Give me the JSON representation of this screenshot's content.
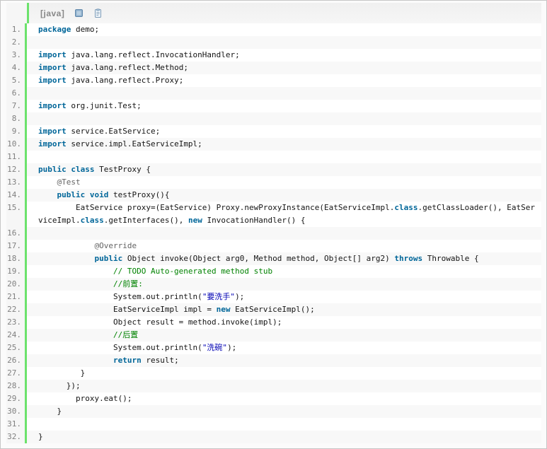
{
  "header": {
    "language_label": "[java]",
    "icons": [
      {
        "name": "view-source-icon"
      },
      {
        "name": "copy-icon"
      }
    ]
  },
  "colors": {
    "keyword": "#006699",
    "plain": "#141414",
    "comment": "#008200",
    "string": "#0000B3",
    "annotation": "#646464",
    "line_number": "#808080",
    "gutter_bg": "#f6f6f6",
    "gutter_border": "#6CE26C",
    "alt_row": "#f8f8f8",
    "header_label": "#888888"
  },
  "code": {
    "language": "java",
    "lines": [
      {
        "number": "1.",
        "segments": [
          {
            "text": "package",
            "type": "keyword"
          },
          {
            "text": " demo;",
            "type": "plain"
          }
        ]
      },
      {
        "number": "2.",
        "segments": []
      },
      {
        "number": "3.",
        "segments": [
          {
            "text": "import",
            "type": "keyword"
          },
          {
            "text": " java.lang.reflect.InvocationHandler;",
            "type": "plain"
          }
        ]
      },
      {
        "number": "4.",
        "segments": [
          {
            "text": "import",
            "type": "keyword"
          },
          {
            "text": " java.lang.reflect.Method;",
            "type": "plain"
          }
        ]
      },
      {
        "number": "5.",
        "segments": [
          {
            "text": "import",
            "type": "keyword"
          },
          {
            "text": " java.lang.reflect.Proxy;",
            "type": "plain"
          }
        ]
      },
      {
        "number": "6.",
        "segments": []
      },
      {
        "number": "7.",
        "segments": [
          {
            "text": "import",
            "type": "keyword"
          },
          {
            "text": " org.junit.Test;",
            "type": "plain"
          }
        ]
      },
      {
        "number": "8.",
        "segments": []
      },
      {
        "number": "9.",
        "segments": [
          {
            "text": "import",
            "type": "keyword"
          },
          {
            "text": " service.EatService;",
            "type": "plain"
          }
        ]
      },
      {
        "number": "10.",
        "segments": [
          {
            "text": "import",
            "type": "keyword"
          },
          {
            "text": " service.impl.EatServiceImpl;",
            "type": "plain"
          }
        ]
      },
      {
        "number": "11.",
        "segments": []
      },
      {
        "number": "12.",
        "segments": [
          {
            "text": "public",
            "type": "keyword"
          },
          {
            "text": " ",
            "type": "plain"
          },
          {
            "text": "class",
            "type": "keyword"
          },
          {
            "text": " TestProxy {",
            "type": "plain"
          }
        ]
      },
      {
        "number": "13.",
        "segments": [
          {
            "text": "    ",
            "type": "plain"
          },
          {
            "text": "@Test",
            "type": "annotation"
          }
        ]
      },
      {
        "number": "14.",
        "segments": [
          {
            "text": "    ",
            "type": "plain"
          },
          {
            "text": "public",
            "type": "keyword"
          },
          {
            "text": " ",
            "type": "plain"
          },
          {
            "text": "void",
            "type": "keyword"
          },
          {
            "text": " testProxy(){",
            "type": "plain"
          }
        ]
      },
      {
        "number": "15.",
        "segments": [
          {
            "text": "        EatService proxy=(EatService) Proxy.newProxyInstance(EatServiceImpl.",
            "type": "plain"
          },
          {
            "text": "class",
            "type": "keyword"
          },
          {
            "text": ".getClassLoader(), EatSer\nviceImpl.",
            "type": "plain"
          },
          {
            "text": "class",
            "type": "keyword"
          },
          {
            "text": ".getInterfaces(), ",
            "type": "plain"
          },
          {
            "text": "new",
            "type": "keyword"
          },
          {
            "text": " InvocationHandler() {",
            "type": "plain"
          }
        ]
      },
      {
        "number": "16.",
        "segments": []
      },
      {
        "number": "17.",
        "segments": [
          {
            "text": "            ",
            "type": "plain"
          },
          {
            "text": "@Override",
            "type": "annotation"
          }
        ]
      },
      {
        "number": "18.",
        "segments": [
          {
            "text": "            ",
            "type": "plain"
          },
          {
            "text": "public",
            "type": "keyword"
          },
          {
            "text": " Object invoke(Object arg0, Method method, Object[] arg2) ",
            "type": "plain"
          },
          {
            "text": "throws",
            "type": "keyword"
          },
          {
            "text": " Throwable {",
            "type": "plain"
          }
        ]
      },
      {
        "number": "19.",
        "segments": [
          {
            "text": "                ",
            "type": "plain"
          },
          {
            "text": "// TODO Auto-generated method stub",
            "type": "comment"
          }
        ]
      },
      {
        "number": "20.",
        "segments": [
          {
            "text": "                ",
            "type": "plain"
          },
          {
            "text": "//前置:",
            "type": "comment"
          }
        ]
      },
      {
        "number": "21.",
        "segments": [
          {
            "text": "                System.out.println(",
            "type": "plain"
          },
          {
            "text": "\"要洗手\"",
            "type": "string"
          },
          {
            "text": ");",
            "type": "plain"
          }
        ]
      },
      {
        "number": "22.",
        "segments": [
          {
            "text": "                EatServiceImpl impl = ",
            "type": "plain"
          },
          {
            "text": "new",
            "type": "keyword"
          },
          {
            "text": " EatServiceImpl();",
            "type": "plain"
          }
        ]
      },
      {
        "number": "23.",
        "segments": [
          {
            "text": "                Object result = method.invoke(impl);",
            "type": "plain"
          }
        ]
      },
      {
        "number": "24.",
        "segments": [
          {
            "text": "                ",
            "type": "plain"
          },
          {
            "text": "//后置",
            "type": "comment"
          }
        ]
      },
      {
        "number": "25.",
        "segments": [
          {
            "text": "                System.out.println(",
            "type": "plain"
          },
          {
            "text": "\"洗碗\"",
            "type": "string"
          },
          {
            "text": ");",
            "type": "plain"
          }
        ]
      },
      {
        "number": "26.",
        "segments": [
          {
            "text": "                ",
            "type": "plain"
          },
          {
            "text": "return",
            "type": "keyword"
          },
          {
            "text": " result;",
            "type": "plain"
          }
        ]
      },
      {
        "number": "27.",
        "segments": [
          {
            "text": "         }",
            "type": "plain"
          }
        ]
      },
      {
        "number": "28.",
        "segments": [
          {
            "text": "      });",
            "type": "plain"
          }
        ]
      },
      {
        "number": "29.",
        "segments": [
          {
            "text": "        proxy.eat();",
            "type": "plain"
          }
        ]
      },
      {
        "number": "30.",
        "segments": [
          {
            "text": "    }",
            "type": "plain"
          }
        ]
      },
      {
        "number": "31.",
        "segments": []
      },
      {
        "number": "32.",
        "segments": [
          {
            "text": "}",
            "type": "plain"
          }
        ]
      }
    ]
  }
}
